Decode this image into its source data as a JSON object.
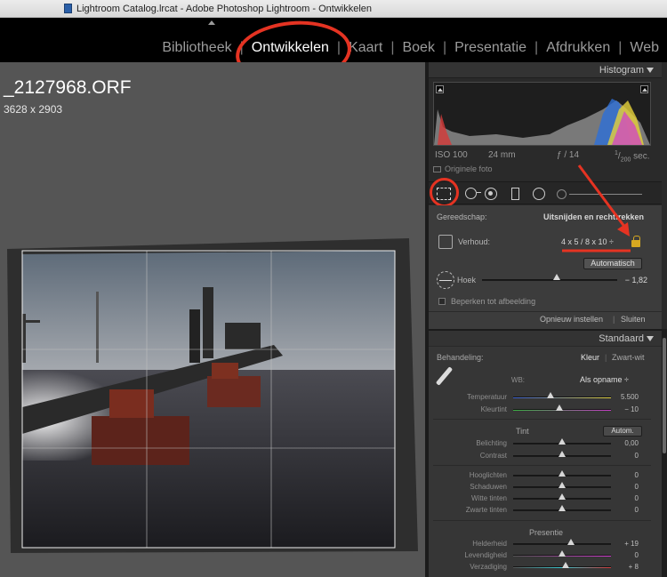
{
  "window": {
    "title": "Lightroom Catalog.lrcat - Adobe Photoshop Lightroom - Ontwikkelen"
  },
  "modules": [
    {
      "label": "Bibliotheek"
    },
    {
      "label": "Ontwikkelen"
    },
    {
      "label": "Kaart"
    },
    {
      "label": "Boek"
    },
    {
      "label": "Presentatie"
    },
    {
      "label": "Afdrukken"
    },
    {
      "label": "Web"
    }
  ],
  "active_module": "Ontwikkelen",
  "image": {
    "filename": "_2127968.ORF",
    "dimensions": "3628 x 2903"
  },
  "histogram": {
    "title": "Histogram",
    "iso": "ISO 100",
    "focal": "24 mm",
    "aperture": "ƒ / 14",
    "shutter_num": "1",
    "shutter_den": "200",
    "shutter_unit": "sec.",
    "original_label": "Originele foto"
  },
  "crop": {
    "tool_label": "Gereedschap:",
    "tool_value": "Uitsnijden en rechttrekken",
    "aspect_label": "Verhoud:",
    "aspect_value": "4 x 5  /  8 x 10  ÷",
    "auto_button": "Automatisch",
    "angle_label": "Hoek",
    "angle_value": "− 1,82",
    "angle_fraction": 0.55,
    "constrain_label": "Beperken tot afbeelding",
    "reset_button": "Opnieuw instellen",
    "close_button": "Sluiten"
  },
  "basic": {
    "header": "Standaard",
    "treatment_label": "Behandeling:",
    "treatment_color": "Kleur",
    "treatment_bw": "Zwart-wit",
    "wb_label": "WB:",
    "wb_value": "Als opname ÷",
    "temperature_label": "Temperatuur",
    "temperature_value": "5.500",
    "temperature_fraction": 0.38,
    "tint_label": "Kleurtint",
    "tint_value": "− 10",
    "tint_fraction": 0.47,
    "tone_header": "Tint",
    "auto_button": "Autom.",
    "exposure_label": "Belichting",
    "exposure_value": "0,00",
    "contrast_label": "Contrast",
    "contrast_value": "0",
    "highlights_label": "Hooglichten",
    "highlights_value": "0",
    "shadows_label": "Schaduwen",
    "shadows_value": "0",
    "whites_label": "Witte tinten",
    "whites_value": "0",
    "blacks_label": "Zwarte tinten",
    "blacks_value": "0",
    "presence_header": "Presentie",
    "clarity_label": "Helderheid",
    "clarity_value": "+ 19",
    "clarity_fraction": 0.595,
    "vibrance_label": "Levendigheid",
    "vibrance_value": "0",
    "saturation_label": "Verzadiging",
    "saturation_value": "+ 8",
    "saturation_fraction": 0.54
  },
  "colors": {
    "annotation": "#e53322",
    "lock": "#d6a821",
    "panel_bg": "#2a2a2a"
  }
}
